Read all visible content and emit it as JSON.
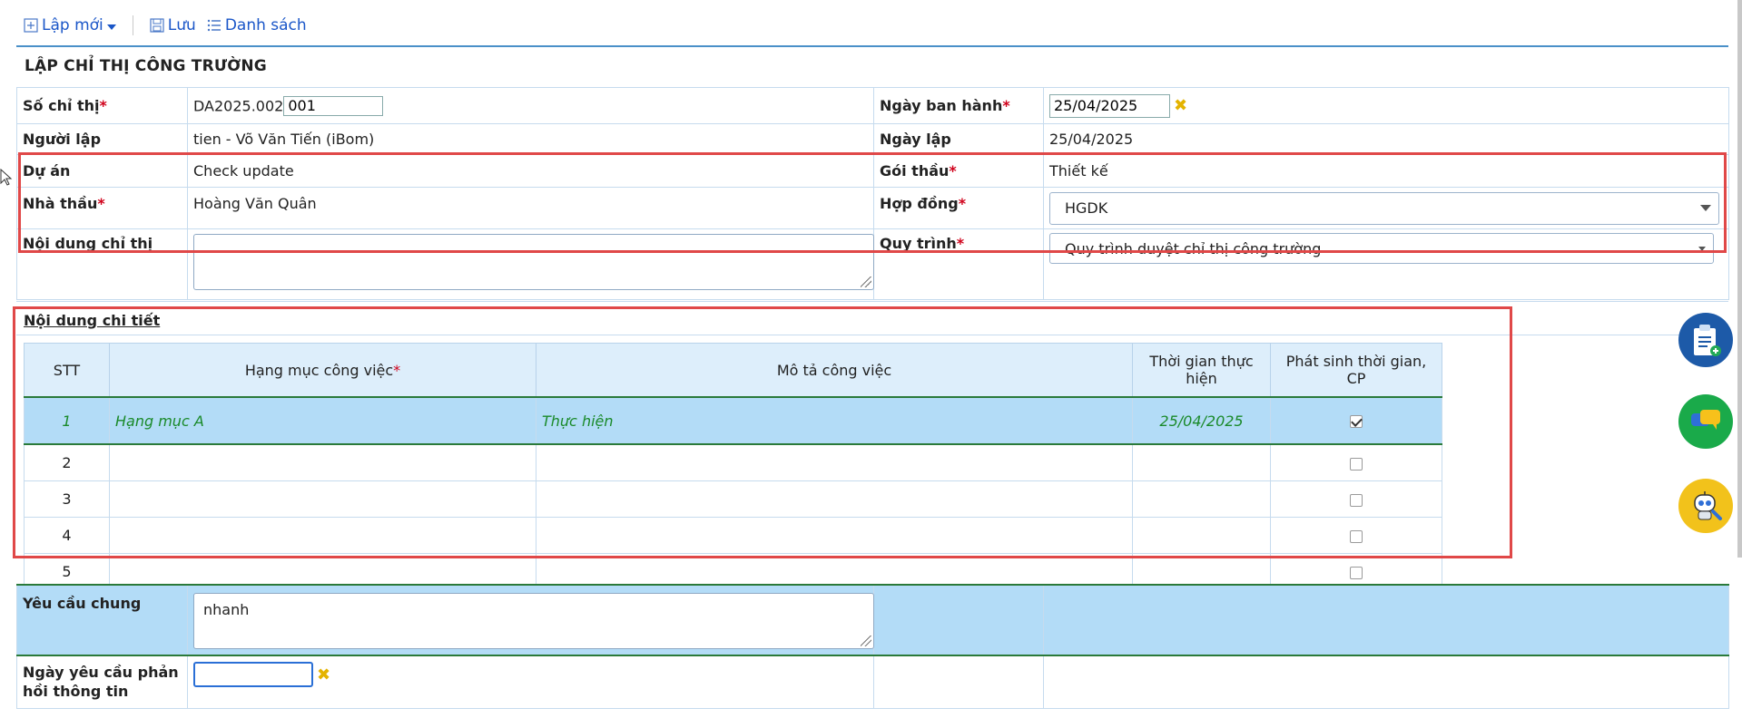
{
  "toolbar": {
    "new_label": "Lập mới",
    "save_label": "Lưu",
    "list_label": "Danh sách"
  },
  "page_title": "LẬP CHỈ THỊ CÔNG TRƯỜNG",
  "form": {
    "so_chi_thi_label": "Số chỉ thị",
    "so_chi_thi_prefix": "DA2025.002",
    "so_chi_thi_value": "001",
    "ngay_ban_hanh_label": "Ngày ban hành",
    "ngay_ban_hanh_value": "25/04/2025",
    "nguoi_lap_label": "Người lập",
    "nguoi_lap_value": "tien - Võ Văn Tiến (iBom)",
    "ngay_lap_label": "Ngày lập",
    "ngay_lap_value": "25/04/2025",
    "du_an_label": "Dự án",
    "du_an_value": "Check update",
    "goi_thau_label": "Gói thầu",
    "goi_thau_value": "Thiết kế",
    "nha_thau_label": "Nhà thầu",
    "nha_thau_value": "Hoàng Văn Quân",
    "hop_dong_label": "Hợp đồng",
    "hop_dong_value": "HGDK",
    "noi_dung_label": "Nội dung chỉ thị",
    "noi_dung_value": "",
    "quy_trinh_label": "Quy trình",
    "quy_trinh_value": "Quy trình duyệt chỉ thị công trường",
    "required_mark": "*"
  },
  "detail": {
    "section_title": "Nội dung chi tiết",
    "columns": [
      "STT",
      "Hạng mục công việc",
      "Mô tả công việc",
      "Thời gian thực hiện",
      "Phát sinh thời gian, CP"
    ],
    "rows": [
      {
        "stt": "1",
        "hang_muc": "Hạng mục A",
        "mo_ta": "Thực hiện",
        "thoi_gian": "25/04/2025",
        "phat_sinh": true
      },
      {
        "stt": "2",
        "hang_muc": "",
        "mo_ta": "",
        "thoi_gian": "",
        "phat_sinh": false
      },
      {
        "stt": "3",
        "hang_muc": "",
        "mo_ta": "",
        "thoi_gian": "",
        "phat_sinh": false
      },
      {
        "stt": "4",
        "hang_muc": "",
        "mo_ta": "",
        "thoi_gian": "",
        "phat_sinh": false
      },
      {
        "stt": "5",
        "hang_muc": "",
        "mo_ta": "",
        "thoi_gian": "",
        "phat_sinh": false
      }
    ]
  },
  "bottom": {
    "yeu_cau_chung_label": "Yêu cầu chung",
    "yeu_cau_chung_value": "nhanh",
    "ngay_yeu_cau_label": "Ngày yêu cầu phản hồi thông tin",
    "ngay_yeu_cau_value": ""
  },
  "colors": {
    "accent": "#1a56c8",
    "required": "#d0021b",
    "highlight_row": "#b3dcf7",
    "annotation_box": "#e04848"
  },
  "fabs": [
    "clipboard-add-icon",
    "chat-icon",
    "robot-support-icon"
  ]
}
